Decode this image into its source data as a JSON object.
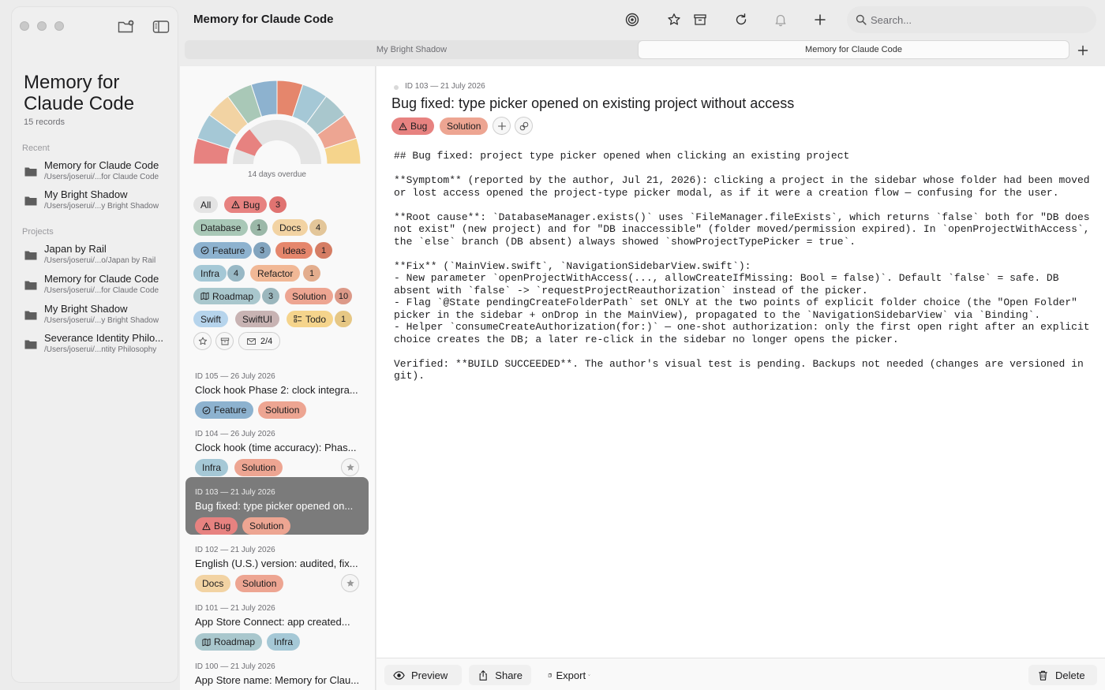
{
  "window": {
    "title": "Memory for Claude Code"
  },
  "sidebar": {
    "title": "Memory for Claude Code",
    "record_count": "15 records",
    "recent_label": "Recent",
    "recent": [
      {
        "name": "Memory for Claude Code",
        "path": "/Users/joserui/...for Claude Code"
      },
      {
        "name": "My Bright Shadow",
        "path": "/Users/joserui/...y Bright Shadow"
      }
    ],
    "projects_label": "Projects",
    "projects": [
      {
        "name": "Japan by Rail",
        "path": "/Users/joserui/...o/Japan by Rail"
      },
      {
        "name": "Memory for Claude Code",
        "path": "/Users/joserui/...for Claude Code"
      },
      {
        "name": "My Bright Shadow",
        "path": "/Users/joserui/...y Bright Shadow"
      },
      {
        "name": "Severance Identity Philo...",
        "path": "/Users/joserui/...ntity Philosophy"
      }
    ]
  },
  "toolbar": {
    "title": "Memory for Claude Code",
    "search_placeholder": "Search...",
    "icons": [
      "target-icon",
      "star-icon",
      "archive-icon",
      "refresh-icon",
      "bell-icon",
      "plus-icon",
      "search-icon"
    ]
  },
  "tabs": [
    {
      "label": "My Bright Shadow",
      "active": false
    },
    {
      "label": "Memory for Claude Code",
      "active": true
    }
  ],
  "overview": {
    "caption": "14 days overdue",
    "gauge_segments_colors": [
      "#e78280",
      "#a5c8d6",
      "#f2d3a3",
      "#a9c8b7",
      "#8db2cf",
      "#e5866c",
      "#a5c8d6",
      "#a9c7cd",
      "#eda592",
      "#f5d48c"
    ]
  },
  "filters": {
    "all": "All",
    "tags": [
      {
        "label": "Bug",
        "count": "3"
      },
      {
        "label": "Database",
        "count": "1"
      },
      {
        "label": "Docs",
        "count": "4"
      },
      {
        "label": "Feature",
        "count": "3"
      },
      {
        "label": "Ideas",
        "count": "1"
      },
      {
        "label": "Infra",
        "count": "4"
      },
      {
        "label": "Refactor",
        "count": "1"
      },
      {
        "label": "Roadmap",
        "count": "3"
      },
      {
        "label": "Solution",
        "count": "10"
      },
      {
        "label": "Swift",
        "count": ""
      },
      {
        "label": "SwiftUI",
        "count": ""
      },
      {
        "label": "Todo",
        "count": "1"
      }
    ],
    "progress_label": "2/4"
  },
  "records": [
    {
      "meta": "ID 105 — 26 July 2026",
      "title": "Clock hook Phase 2: clock integra...",
      "tags": [
        "Feature",
        "Solution"
      ]
    },
    {
      "meta": "ID 104 — 26 July 2026",
      "title": "Clock hook (time accuracy): Phas...",
      "tags": [
        "Infra",
        "Solution"
      ]
    },
    {
      "meta": "ID 103 — 21 July 2026",
      "title": "Bug fixed: type picker opened on...",
      "tags": [
        "Bug",
        "Solution"
      ]
    },
    {
      "meta": "ID 102 — 21 July 2026",
      "title": "English (U.S.) version: audited, fix...",
      "tags": [
        "Docs",
        "Solution"
      ]
    },
    {
      "meta": "ID 101 — 21 July 2026",
      "title": "App Store Connect: app created...",
      "tags": [
        "Roadmap",
        "Infra"
      ]
    },
    {
      "meta": "ID 100 — 21 July 2026",
      "title": "App Store name: Memory for Clau...",
      "tags": []
    }
  ],
  "detail": {
    "meta": "ID 103 — 21 July 2026",
    "title": "Bug fixed: type picker opened on existing project without access",
    "tags": [
      "Bug",
      "Solution"
    ],
    "body": "## Bug fixed: project type picker opened when clicking an existing project\n\n**Symptom** (reported by the author, Jul 21, 2026): clicking a project in the sidebar whose folder had been moved or lost access opened the project-type picker modal, as if it were a creation flow — confusing for the user.\n\n**Root cause**: `DatabaseManager.exists()` uses `FileManager.fileExists`, which returns `false` both for \"DB does not exist\" (new project) and for \"DB inaccessible\" (folder moved/permission expired). In `openProjectWithAccess`, the `else` branch (DB absent) always showed `showProjectTypePicker = true`.\n\n**Fix** (`MainView.swift`, `NavigationSidebarView.swift`):\n- New parameter `openProjectWithAccess(..., allowCreateIfMissing: Bool = false)`. Default `false` = safe. DB absent with `false` -> `requestProjectReauthorization` instead of the picker.\n- Flag `@State pendingCreateFolderPath` set ONLY at the two points of explicit folder choice (the \"Open Folder\" picker in the sidebar + onDrop in the MainView), propagated to the `NavigationSidebarView` via `Binding`.\n- Helper `consumeCreateAuthorization(for:)` — one-shot authorization: only the first open right after an explicit choice creates the DB; a later re-click in the sidebar no longer opens the picker.\n\nVerified: **BUILD SUCCEEDED**. The author's visual test is pending. Backups not needed (changes are versioned in git)."
  },
  "footer": {
    "preview": "Preview",
    "share": "Share",
    "export": "Export",
    "delete": "Delete"
  }
}
